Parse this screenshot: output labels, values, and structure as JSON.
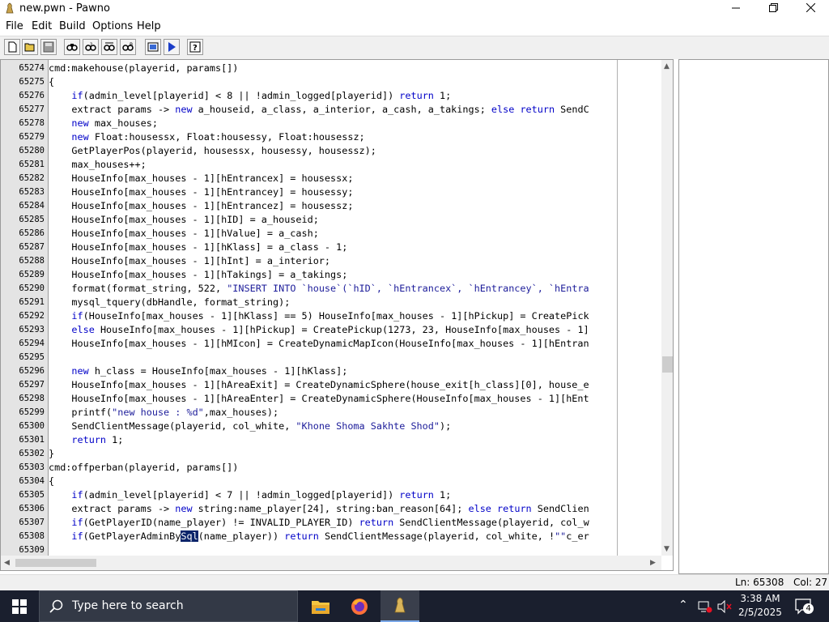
{
  "window": {
    "title": "new.pwn - Pawno"
  },
  "menu": [
    "File",
    "Edit",
    "Build",
    "Options",
    "Help"
  ],
  "toolbar": [
    "new-file-icon",
    "open-file-icon",
    "save-icon",
    "find-icon",
    "find-next-icon",
    "replace-icon",
    "goto-line-icon",
    "compile-icon",
    "run-icon",
    "help-icon"
  ],
  "editor": {
    "lines": [
      {
        "n": "65274",
        "t": "cmd:makehouse(playerid, params[])"
      },
      {
        "n": "65275",
        "t": "{"
      },
      {
        "n": "65276",
        "t": "    if(admin_level[playerid] < 8 || !admin_logged[playerid]) return 1;"
      },
      {
        "n": "65277",
        "t": "    extract params -> new a_houseid, a_class, a_interior, a_cash, a_takings; else return SendC"
      },
      {
        "n": "65278",
        "t": "    new max_houses;"
      },
      {
        "n": "65279",
        "t": "    new Float:housessx, Float:housessy, Float:housessz;"
      },
      {
        "n": "65280",
        "t": "    GetPlayerPos(playerid, housessx, housessy, housessz);"
      },
      {
        "n": "65281",
        "t": "    max_houses++;"
      },
      {
        "n": "65282",
        "t": "    HouseInfo[max_houses - 1][hEntrancex] = housessx;"
      },
      {
        "n": "65283",
        "t": "    HouseInfo[max_houses - 1][hEntrancey] = housessy;"
      },
      {
        "n": "65284",
        "t": "    HouseInfo[max_houses - 1][hEntrancez] = housessz;"
      },
      {
        "n": "65285",
        "t": "    HouseInfo[max_houses - 1][hID] = a_houseid;"
      },
      {
        "n": "65286",
        "t": "    HouseInfo[max_houses - 1][hValue] = a_cash;"
      },
      {
        "n": "65287",
        "t": "    HouseInfo[max_houses - 1][hKlass] = a_class - 1;"
      },
      {
        "n": "65288",
        "t": "    HouseInfo[max_houses - 1][hInt] = a_interior;"
      },
      {
        "n": "65289",
        "t": "    HouseInfo[max_houses - 1][hTakings] = a_takings;"
      },
      {
        "n": "65290",
        "t": "    format(format_string, 522, \"INSERT INTO `house`(`hID`, `hEntrancex`, `hEntrancey`, `hEntra"
      },
      {
        "n": "65291",
        "t": "    mysql_tquery(dbHandle, format_string);"
      },
      {
        "n": "65292",
        "t": "    if(HouseInfo[max_houses - 1][hKlass] == 5) HouseInfo[max_houses - 1][hPickup] = CreatePick"
      },
      {
        "n": "65293",
        "t": "    else HouseInfo[max_houses - 1][hPickup] = CreatePickup(1273, 23, HouseInfo[max_houses - 1]"
      },
      {
        "n": "65294",
        "t": "    HouseInfo[max_houses - 1][hMIcon] = CreateDynamicMapIcon(HouseInfo[max_houses - 1][hEntran"
      },
      {
        "n": "65295",
        "t": ""
      },
      {
        "n": "65296",
        "t": "    new h_class = HouseInfo[max_houses - 1][hKlass];"
      },
      {
        "n": "65297",
        "t": "    HouseInfo[max_houses - 1][hAreaExit] = CreateDynamicSphere(house_exit[h_class][0], house_e"
      },
      {
        "n": "65298",
        "t": "    HouseInfo[max_houses - 1][hAreaEnter] = CreateDynamicSphere(HouseInfo[max_houses - 1][hEnt"
      },
      {
        "n": "65299",
        "t": "    printf(\"new house : %d\",max_houses);"
      },
      {
        "n": "65300",
        "t": "    SendClientMessage(playerid, col_white, \"Khone Shoma Sakhte Shod\");"
      },
      {
        "n": "65301",
        "t": "    return 1;"
      },
      {
        "n": "65302",
        "t": "}"
      },
      {
        "n": "65303",
        "t": "cmd:offperban(playerid, params[])"
      },
      {
        "n": "65304",
        "t": "{"
      },
      {
        "n": "65305",
        "t": "    if(admin_level[playerid] < 7 || !admin_logged[playerid]) return 1;"
      },
      {
        "n": "65306",
        "t": "    extract params -> new string:name_player[24], string:ban_reason[64]; else return SendClien"
      },
      {
        "n": "65307",
        "t": "    if(GetPlayerID(name_player) != INVALID_PLAYER_ID) return SendClientMessage(playerid, col_w"
      },
      {
        "n": "65308",
        "t": "    if(GetPlayerAdminBySql(name_player)) return SendClientMessage(playerid, col_white, !\"\"c_er"
      },
      {
        "n": "65309",
        "t": ""
      }
    ],
    "selected_text": "Sql"
  },
  "status": {
    "line": "Ln: 65308",
    "col": "Col: 27"
  },
  "taskbar": {
    "search_placeholder": "Type here to search",
    "time": "3:38 AM",
    "date": "2/5/2025",
    "notification_count": "4"
  },
  "colors": {
    "keyword": "#0000c8",
    "string": "#1c1c9a",
    "gutter": "#e4e4e4",
    "selection": "#0a246a",
    "taskbar": "#1a1f2e"
  }
}
